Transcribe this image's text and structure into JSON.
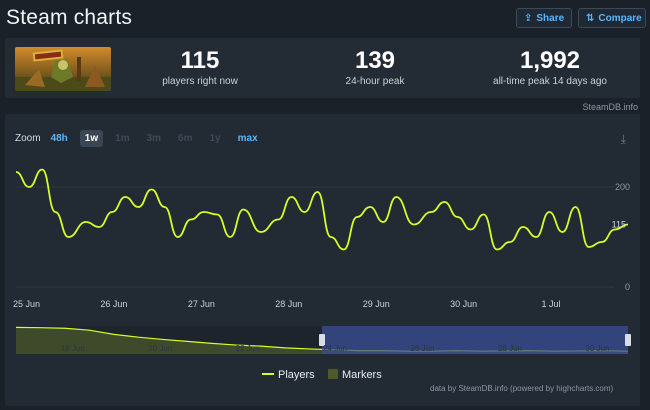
{
  "header": {
    "title": "Steam charts",
    "share_label": "Share",
    "compare_label": "Compare"
  },
  "stats": {
    "players_now": "115",
    "players_now_label": "players right now",
    "peak_24h": "139",
    "peak_24h_label": "24-hour peak",
    "all_time_peak": "1,992",
    "all_time_peak_label": "all-time peak 14 days ago"
  },
  "credit": "SteamDB.info",
  "zoom": {
    "label": "Zoom",
    "options": [
      {
        "label": "48h",
        "state": "enabled"
      },
      {
        "label": "1w",
        "state": "selected"
      },
      {
        "label": "1m",
        "state": "disabled"
      },
      {
        "label": "3m",
        "state": "disabled"
      },
      {
        "label": "6m",
        "state": "disabled"
      },
      {
        "label": "1y",
        "state": "disabled"
      },
      {
        "label": "max",
        "state": "enabled"
      }
    ]
  },
  "icons": {
    "download": "download-icon",
    "share": "share-icon",
    "compare": "compare-icon"
  },
  "colors": {
    "players_line": "#d4ff2a",
    "markers": "#4d5b2b",
    "navigator_fill": "#3e4a2a",
    "navigator_window": "#3a4f96",
    "accent": "#59b6ff"
  },
  "chart_data": {
    "type": "line",
    "x_tick_labels": [
      "25 Jun",
      "26 Jun",
      "27 Jun",
      "28 Jun",
      "29 Jun",
      "30 Jun",
      "1 Jul"
    ],
    "y_ticks": [
      0,
      200
    ],
    "ylim": [
      0,
      250
    ],
    "last_point_label": "115",
    "legend": [
      "Players",
      "Markers"
    ],
    "legend_position": "bottom",
    "series": [
      {
        "name": "Players",
        "x_days": [
          0,
          0.15,
          0.3,
          0.45,
          0.6,
          0.8,
          0.95,
          1.1,
          1.25,
          1.4,
          1.55,
          1.7,
          1.85,
          2.0,
          2.15,
          2.3,
          2.45,
          2.6,
          2.8,
          3.0,
          3.15,
          3.3,
          3.45,
          3.6,
          3.75,
          3.9,
          4.05,
          4.2,
          4.35,
          4.55,
          4.75,
          4.9,
          5.05,
          5.2,
          5.35,
          5.5,
          5.65,
          5.8,
          5.95,
          6.1,
          6.25,
          6.4,
          6.55,
          6.7,
          6.85,
          7.0
        ],
        "values": [
          230,
          200,
          235,
          150,
          100,
          130,
          120,
          150,
          180,
          160,
          195,
          160,
          100,
          135,
          150,
          145,
          100,
          155,
          110,
          135,
          180,
          150,
          190,
          100,
          75,
          140,
          160,
          130,
          180,
          125,
          150,
          170,
          140,
          115,
          145,
          75,
          90,
          120,
          100,
          150,
          110,
          160,
          80,
          90,
          115,
          125
        ]
      }
    ],
    "navigator": {
      "x_tick_labels": [
        "18 Jun",
        "20 Jun",
        "22 Jun",
        "24 Jun",
        "26 Jun",
        "28 Jun",
        "30 Jun"
      ],
      "values": [
        0.95,
        0.94,
        0.92,
        0.85,
        0.7,
        0.6,
        0.52,
        0.45,
        0.38,
        0.32,
        0.28,
        0.22,
        0.18,
        0.15,
        0.12,
        0.12,
        0.1,
        0.1,
        0.12,
        0.1,
        0.11,
        0.12,
        0.1,
        0.11,
        0.12,
        0.1
      ],
      "selected_range_days": [
        7,
        14
      ]
    }
  },
  "footer_credit": "data by SteamDB.info (powered by highcharts.com)"
}
